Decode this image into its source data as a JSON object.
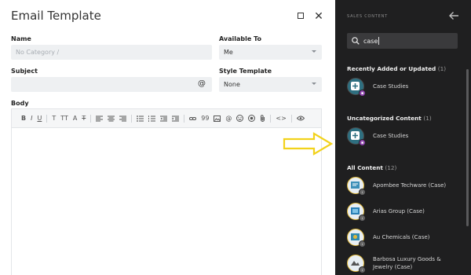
{
  "modal": {
    "title": "Email Template",
    "name_label": "Name",
    "name_placeholder": "No Category /",
    "available_label": "Available To",
    "available_value": "Me",
    "subject_label": "Subject",
    "subject_value": "",
    "style_label": "Style Template",
    "style_value": "None",
    "body_label": "Body",
    "toolbar": {
      "bold": "B",
      "italic": "I",
      "underline": "U",
      "text_color": "T",
      "font_size": "TT",
      "font_family": "A",
      "clear_format": "T",
      "quote": "99",
      "code": "<>"
    }
  },
  "panel": {
    "title": "SALES CONTENT",
    "search_value": "case",
    "sections": [
      {
        "heading": "Recently Added or Updated",
        "count": "(1)"
      },
      {
        "heading": "Uncategorized Content",
        "count": "(1)"
      },
      {
        "heading": "All Content",
        "count": "(12)"
      }
    ],
    "recent_items": [
      "Case Studies"
    ],
    "uncat_items": [
      "Case Studies"
    ],
    "all_items": [
      "Apombee Techware (Case)",
      "Arias Group (Case)",
      "Au Chemicals (Case)",
      "Barbosa Luxury Goods & Jewelry (Case)"
    ]
  },
  "colors": {
    "panel_bg": "#1f1f20",
    "accent_gold": "#e0b83a",
    "arrow_yellow": "#f2d21b",
    "field_bg": "#eef0f2"
  }
}
